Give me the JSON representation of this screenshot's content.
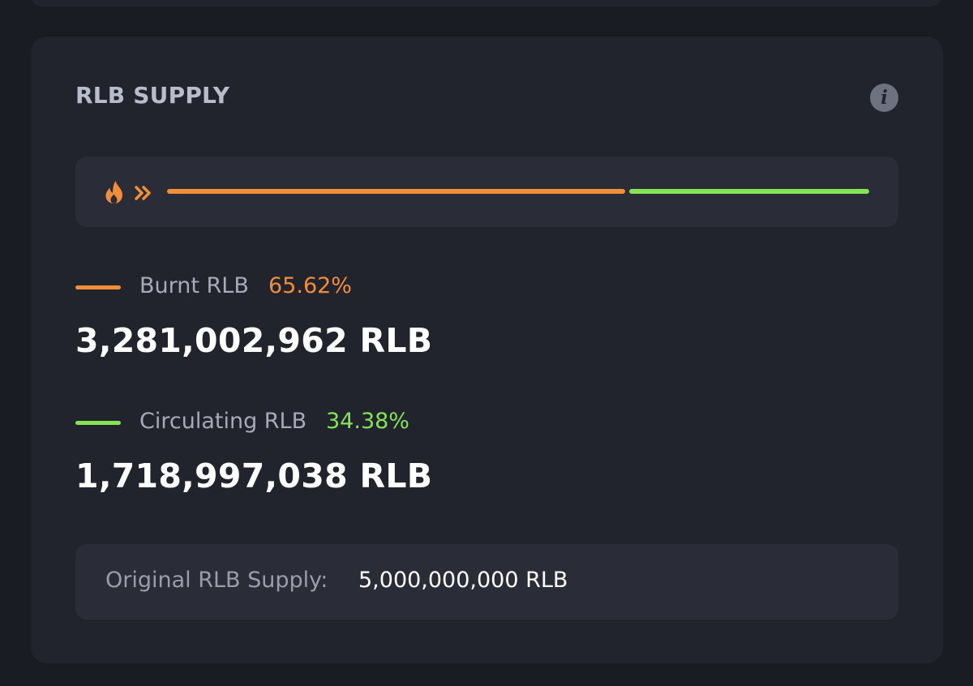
{
  "title": "RLB SUPPLY",
  "info_icon": "info-icon",
  "progress": {
    "burnt_fraction": 0.6562,
    "circulating_fraction": 0.3438,
    "start_icon": "flame-icon",
    "direction_icon": "double-chevron-right-icon"
  },
  "burnt": {
    "label": "Burnt RLB",
    "percent": "65.62%",
    "amount": "3,281,002,962 RLB"
  },
  "circulating": {
    "label": "Circulating RLB",
    "percent": "34.38%",
    "amount": "1,718,997,038 RLB"
  },
  "original": {
    "label": "Original RLB Supply:",
    "value": "5,000,000,000 RLB"
  },
  "colors": {
    "background": "#1a1c24",
    "card": "#21232d",
    "panel": "#2a2d38",
    "burnt": "#f28d3a",
    "circulating": "#86e356",
    "title": "#b9bccb",
    "muted_text": "#a7aab8",
    "value_text": "#ffffff"
  }
}
